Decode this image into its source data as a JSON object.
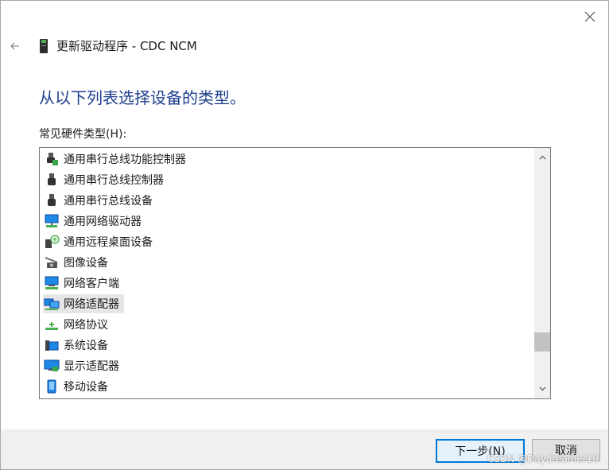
{
  "window": {
    "title": "更新驱动程序 - CDC NCM",
    "heading": "从以下列表选择设备的类型。",
    "list_label": "常见硬件类型(H):"
  },
  "list": {
    "items": [
      {
        "label": "通用串行总线功能控制器",
        "icon": "usb-plug-green-icon"
      },
      {
        "label": "通用串行总线控制器",
        "icon": "usb-plug-icon"
      },
      {
        "label": "通用串行总线设备",
        "icon": "usb-plug-icon"
      },
      {
        "label": "通用网络驱动器",
        "icon": "network-drive-icon"
      },
      {
        "label": "通用远程桌面设备",
        "icon": "remote-desktop-icon"
      },
      {
        "label": "图像设备",
        "icon": "camera-icon"
      },
      {
        "label": "网络客户端",
        "icon": "network-client-icon"
      },
      {
        "label": "网络适配器",
        "icon": "network-adapter-icon",
        "selected": true
      },
      {
        "label": "网络协议",
        "icon": "network-protocol-icon"
      },
      {
        "label": "系统设备",
        "icon": "system-device-icon"
      },
      {
        "label": "显示适配器",
        "icon": "display-adapter-icon"
      },
      {
        "label": "移动设备",
        "icon": "mobile-device-icon"
      }
    ],
    "scroll_position": 0.85
  },
  "buttons": {
    "next": "下一步(N)",
    "cancel": "取消"
  },
  "watermark": "CSDN @Daydreamer10"
}
